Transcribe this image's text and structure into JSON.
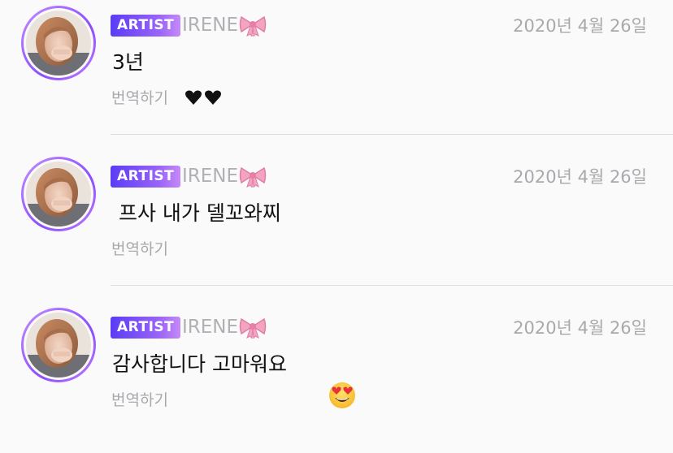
{
  "comments": [
    {
      "badge": "ARTIST",
      "author": "IRENE",
      "author_emoji": "bow-icon",
      "date": "2020년 4월 26일",
      "message": "3년",
      "message_suffix": "two-black-hearts",
      "translate_label": "번역하기"
    },
    {
      "badge": "ARTIST",
      "author": "IRENE",
      "author_emoji": "bow-icon",
      "date": "2020년 4월 26일",
      "message": " 프사 내가 델꼬와찌",
      "message_suffix": "",
      "translate_label": "번역하기"
    },
    {
      "badge": "ARTIST",
      "author": "IRENE",
      "author_emoji": "bow-icon",
      "date": "2020년 4월 26일",
      "message": "감사합니다 고마워요",
      "message_suffix": "heart-eyes-emoji",
      "translate_label": "번역하기"
    }
  ],
  "colors": {
    "badge_start": "#5a3cf5",
    "badge_end": "#c58af7",
    "avatar_ring": "#8a4dff",
    "muted_text": "#a9a9ad",
    "divider": "#dedede"
  }
}
